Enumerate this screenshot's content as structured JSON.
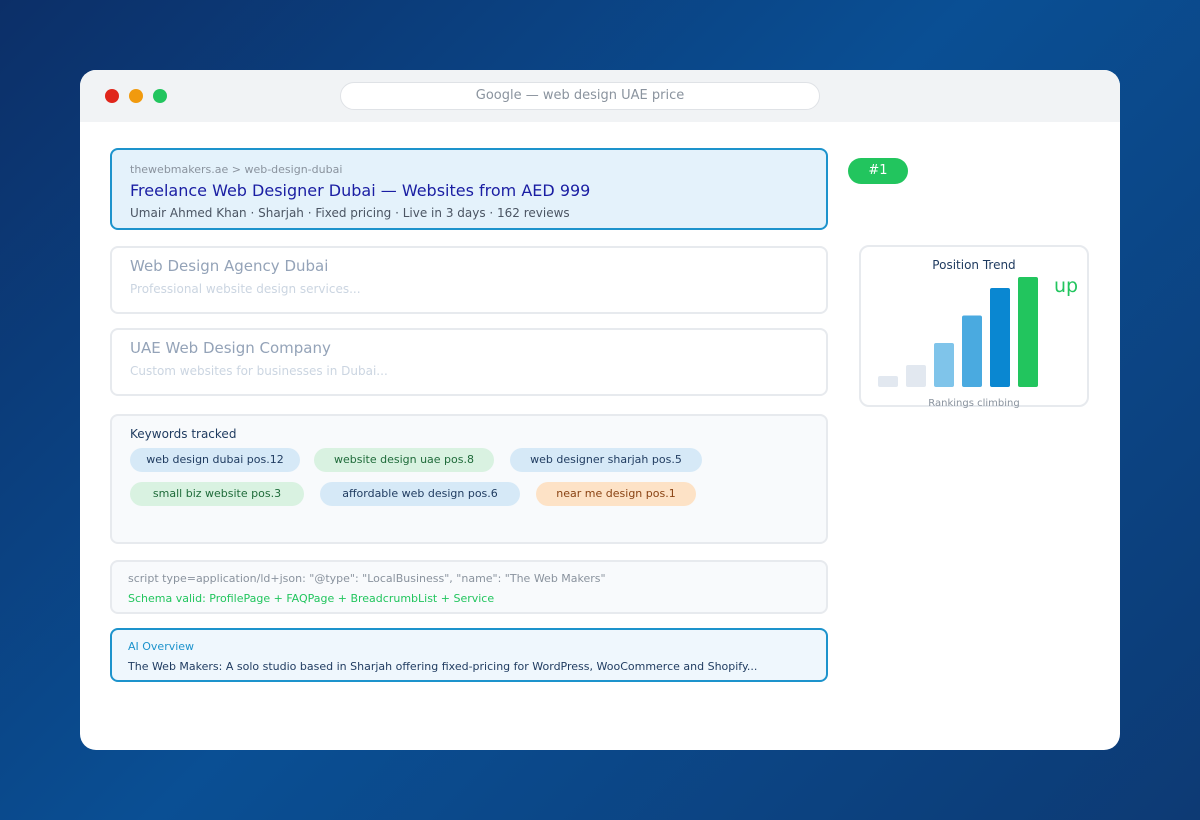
{
  "window": {
    "url_bar": "Google — web design UAE price",
    "traffic_lights": {
      "close": "#e0251b",
      "minimize": "#f19a0e",
      "maximize": "#22c55e"
    }
  },
  "results": {
    "featured": {
      "breadcrumb": "thewebmakers.ae > web-design-dubai",
      "title": "Freelance Web Designer Dubai — Websites from AED 999",
      "meta": "Umair Ahmed Khan · Sharjah · Fixed pricing · Live in 3 days · 162 reviews",
      "rank_badge": "#1"
    },
    "others": [
      {
        "title": "Web Design Agency Dubai",
        "description": "Professional website design services..."
      },
      {
        "title": "UAE Web Design Company",
        "description": "Custom websites for businesses in Dubai..."
      }
    ]
  },
  "keywords": {
    "heading": "Keywords tracked",
    "chips": [
      {
        "label": "web design dubai pos.12",
        "color": "blue"
      },
      {
        "label": "website design uae pos.8",
        "color": "green"
      },
      {
        "label": "web designer sharjah pos.5",
        "color": "blue"
      },
      {
        "label": "small biz website pos.3",
        "color": "green"
      },
      {
        "label": "affordable web design pos.6",
        "color": "blue"
      },
      {
        "label": "near me design pos.1",
        "color": "orange"
      }
    ]
  },
  "schema": {
    "code": "script type=application/ld+json: \"@type\": \"LocalBusiness\", \"name\": \"The Web Makers\"",
    "status": "Schema valid: ProfilePage + FAQPage + BreadcrumbList + Service"
  },
  "ai_overview": {
    "label": "AI Overview",
    "text": "The Web Makers: A solo studio based in Sharjah offering fixed-pricing for WordPress, WooCommerce and Shopify..."
  },
  "trend": {
    "title": "Position Trend",
    "indicator": "up",
    "caption": "Rankings climbing",
    "colors": [
      "#e2e8f0",
      "#e2e8f0",
      "#7fc4ea",
      "#4aaae0",
      "#0a87d1",
      "#22c55e"
    ]
  },
  "chart_data": {
    "type": "bar",
    "title": "Position Trend",
    "categories": [
      "",
      "",
      "",
      "",
      "",
      ""
    ],
    "values": [
      1,
      2,
      4,
      6.5,
      9,
      10
    ],
    "ylim": [
      0,
      10
    ],
    "grid": false
  }
}
